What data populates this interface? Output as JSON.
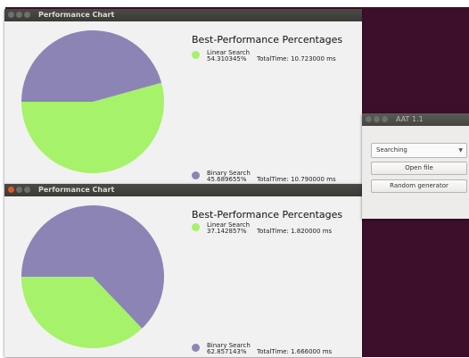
{
  "colors": {
    "linear": "#a6f26a",
    "binary": "#8c84b5",
    "desktop": "#3d0f2b"
  },
  "charts": [
    {
      "window_title": "Performance Chart",
      "chart_data": {
        "type": "pie",
        "title": "Best-Performance Percentages",
        "series": [
          {
            "name": "Linear Search",
            "value": 54.310345,
            "percent_label": "54.310345%",
            "total_time": "TotalTime: 10.723000 ms"
          },
          {
            "name": "Binary Search",
            "value": 45.689655,
            "percent_label": "45.689655%",
            "total_time": "TotalTime: 10.790000 ms"
          }
        ]
      }
    },
    {
      "window_title": "Performance Chart",
      "chart_data": {
        "type": "pie",
        "title": "Best-Performance Percentages",
        "series": [
          {
            "name": "Linear Search",
            "value": 37.142857,
            "percent_label": "37.142857%",
            "total_time": "TotalTime: 1.820000 ms"
          },
          {
            "name": "Binary Search",
            "value": 62.857143,
            "percent_label": "62.857143%",
            "total_time": "TotalTime: 1.666000 ms"
          }
        ]
      }
    }
  ],
  "aat": {
    "window_title": "AAT 1.1",
    "combo_value": "Searching",
    "open_file_label": "Open file",
    "random_generator_label": "Random generator"
  }
}
